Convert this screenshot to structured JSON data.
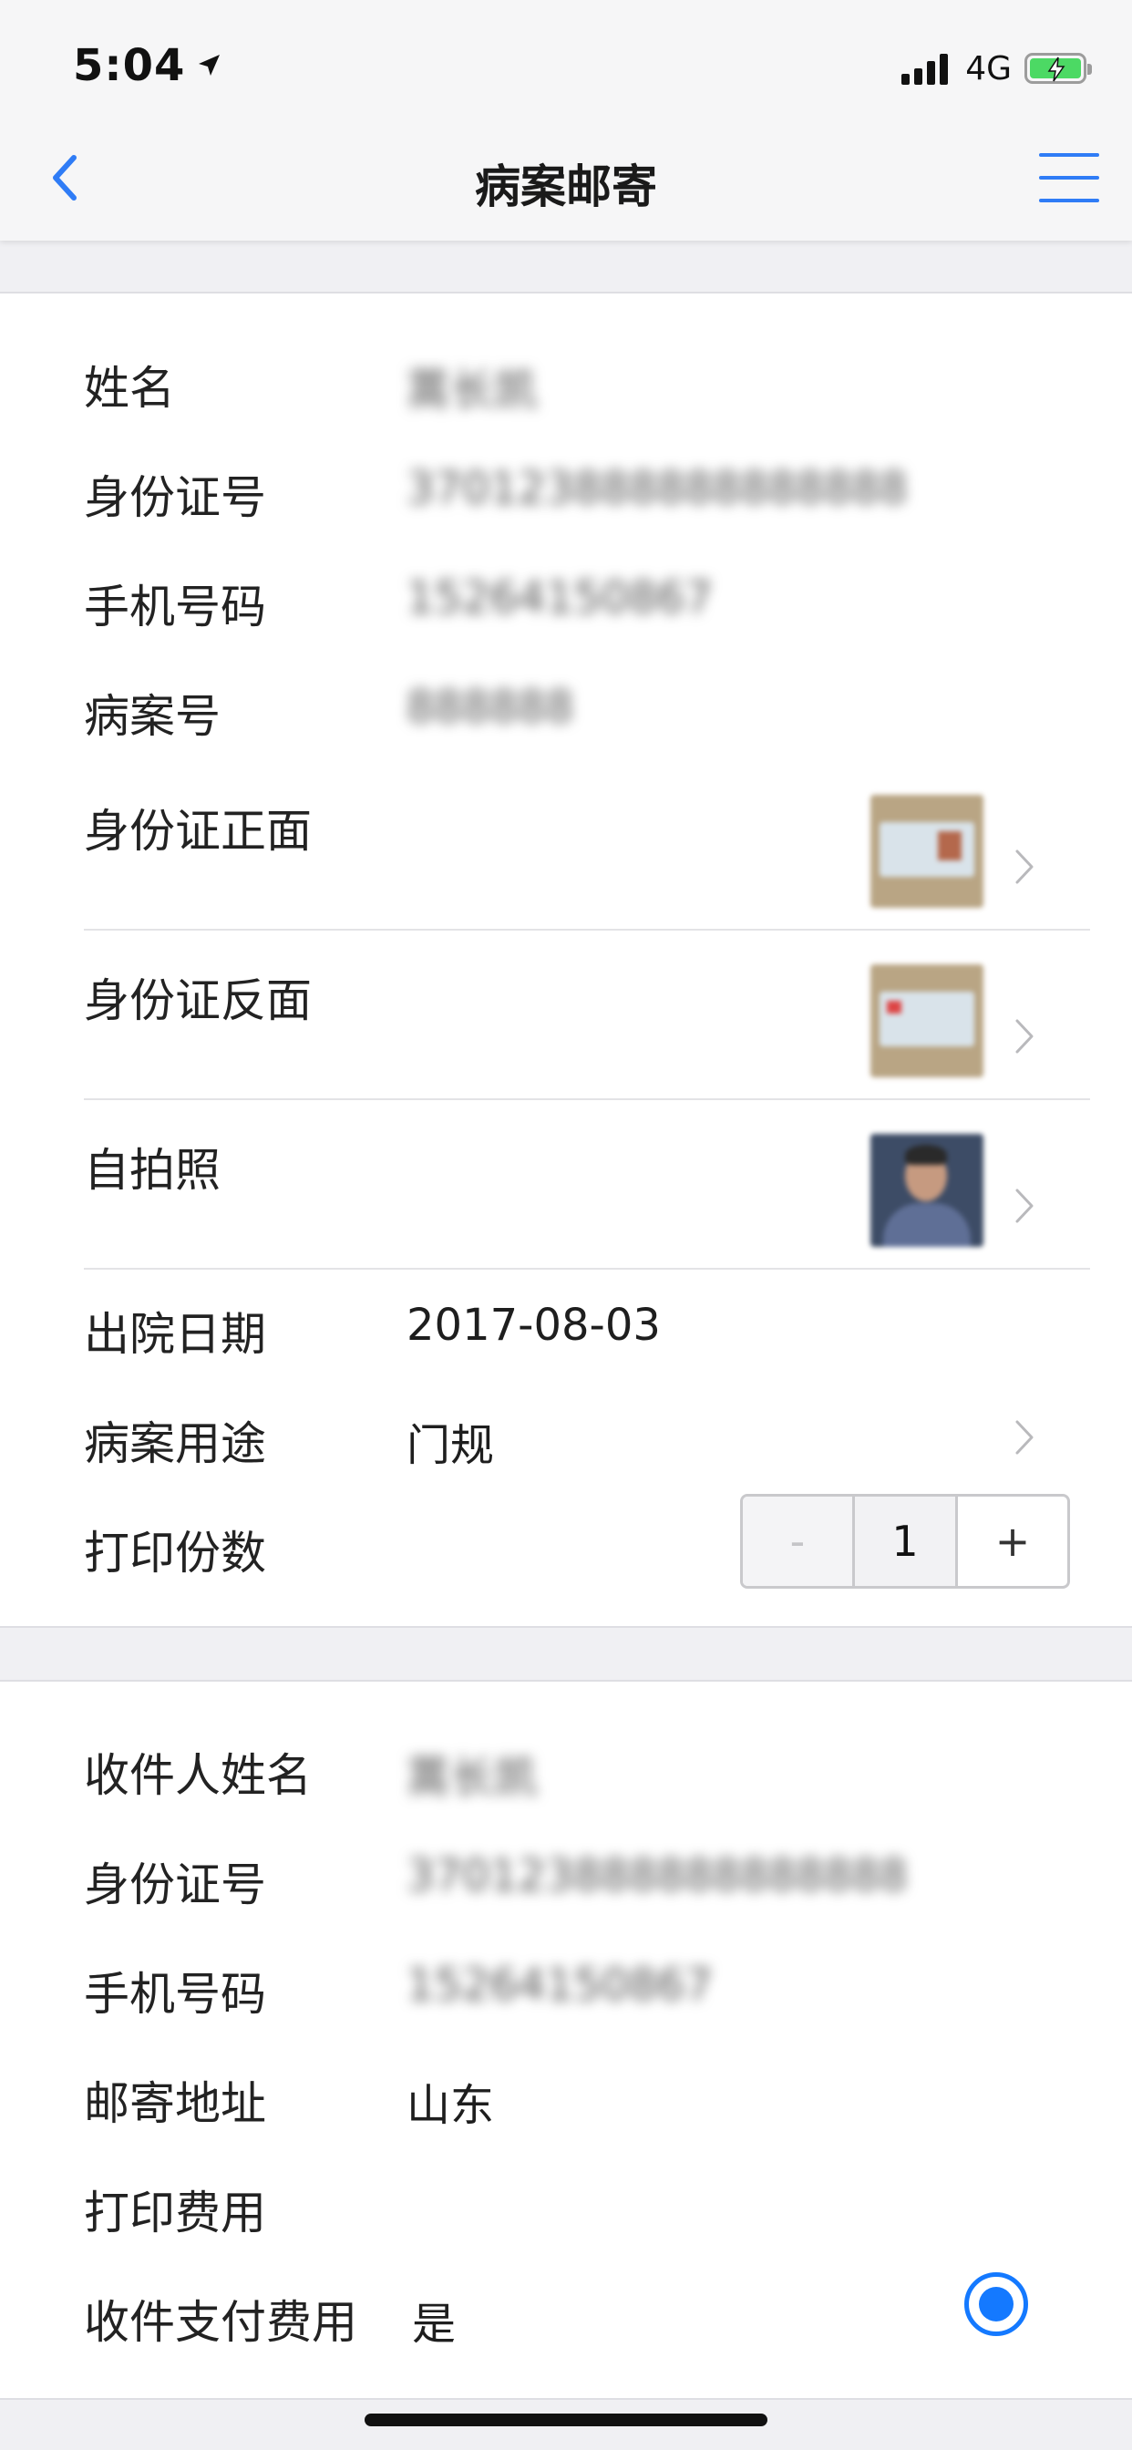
{
  "status_bar": {
    "time": "5:04",
    "network": "4G"
  },
  "nav": {
    "title": "病案邮寄"
  },
  "patient": {
    "name_label": "姓名",
    "name_value": "蒿长凯",
    "id_label": "身份证号",
    "id_value": "370123888888888888",
    "phone_label": "手机号码",
    "phone_value": "15264150867",
    "record_label": "病案号",
    "record_value": "888888",
    "id_front_label": "身份证正面",
    "id_back_label": "身份证反面",
    "selfie_label": "自拍照",
    "discharge_label": "出院日期",
    "discharge_value": "2017-08-03",
    "purpose_label": "病案用途",
    "purpose_value": "门规",
    "copies_label": "打印份数",
    "copies_value": "1",
    "minus_label": "-",
    "plus_label": "+"
  },
  "recipient": {
    "name_label": "收件人姓名",
    "name_value": "蒿长凯",
    "id_label": "身份证号",
    "id_value": "370123888888888888",
    "phone_label": "手机号码",
    "phone_value": "15264150867",
    "address_label": "邮寄地址",
    "address_value": "山东",
    "fee_label": "打印费用",
    "pay_label": "收件支付费用",
    "pay_value": "是"
  },
  "colors": {
    "accent": "#1479ff",
    "battery": "#4cd964"
  }
}
